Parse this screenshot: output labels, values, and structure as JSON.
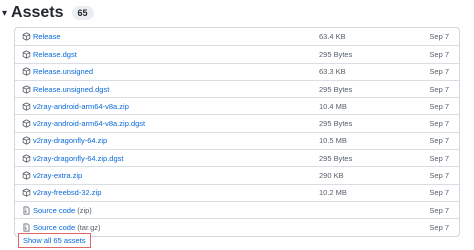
{
  "header": {
    "caret": "▾",
    "title": "Assets",
    "count": "65"
  },
  "assets": [
    {
      "icon": "package-icon",
      "name": "Release",
      "suffix": "",
      "size": "63.4 KB",
      "date": "Sep 7"
    },
    {
      "icon": "package-icon",
      "name": "Release.dgst",
      "suffix": "",
      "size": "295 Bytes",
      "date": "Sep 7"
    },
    {
      "icon": "package-icon",
      "name": "Release.unsigned",
      "suffix": "",
      "size": "63.3 KB",
      "date": "Sep 7"
    },
    {
      "icon": "package-icon",
      "name": "Release.unsigned.dgst",
      "suffix": "",
      "size": "295 Bytes",
      "date": "Sep 7"
    },
    {
      "icon": "package-icon",
      "name": "v2ray-android-arm64-v8a.zip",
      "suffix": "",
      "size": "10.4 MB",
      "date": "Sep 7"
    },
    {
      "icon": "package-icon",
      "name": "v2ray-android-arm64-v8a.zip.dgst",
      "suffix": "",
      "size": "295 Bytes",
      "date": "Sep 7"
    },
    {
      "icon": "package-icon",
      "name": "v2ray-dragonfly-64.zip",
      "suffix": "",
      "size": "10.5 MB",
      "date": "Sep 7"
    },
    {
      "icon": "package-icon",
      "name": "v2ray-dragonfly-64.zip.dgst",
      "suffix": "",
      "size": "295 Bytes",
      "date": "Sep 7"
    },
    {
      "icon": "package-icon",
      "name": "v2ray-extra.zip",
      "suffix": "",
      "size": "290 KB",
      "date": "Sep 7"
    },
    {
      "icon": "package-icon",
      "name": "v2ray-freebsd-32.zip",
      "suffix": "",
      "size": "10.2 MB",
      "date": "Sep 7"
    },
    {
      "icon": "file-zip-icon",
      "name": "Source code ",
      "suffix": "(zip)",
      "size": "",
      "date": "Sep 7"
    },
    {
      "icon": "file-zip-icon",
      "name": "Source code ",
      "suffix": "(tar.gz)",
      "size": "",
      "date": "Sep 7"
    }
  ],
  "show_all": "Show all 65 assets"
}
